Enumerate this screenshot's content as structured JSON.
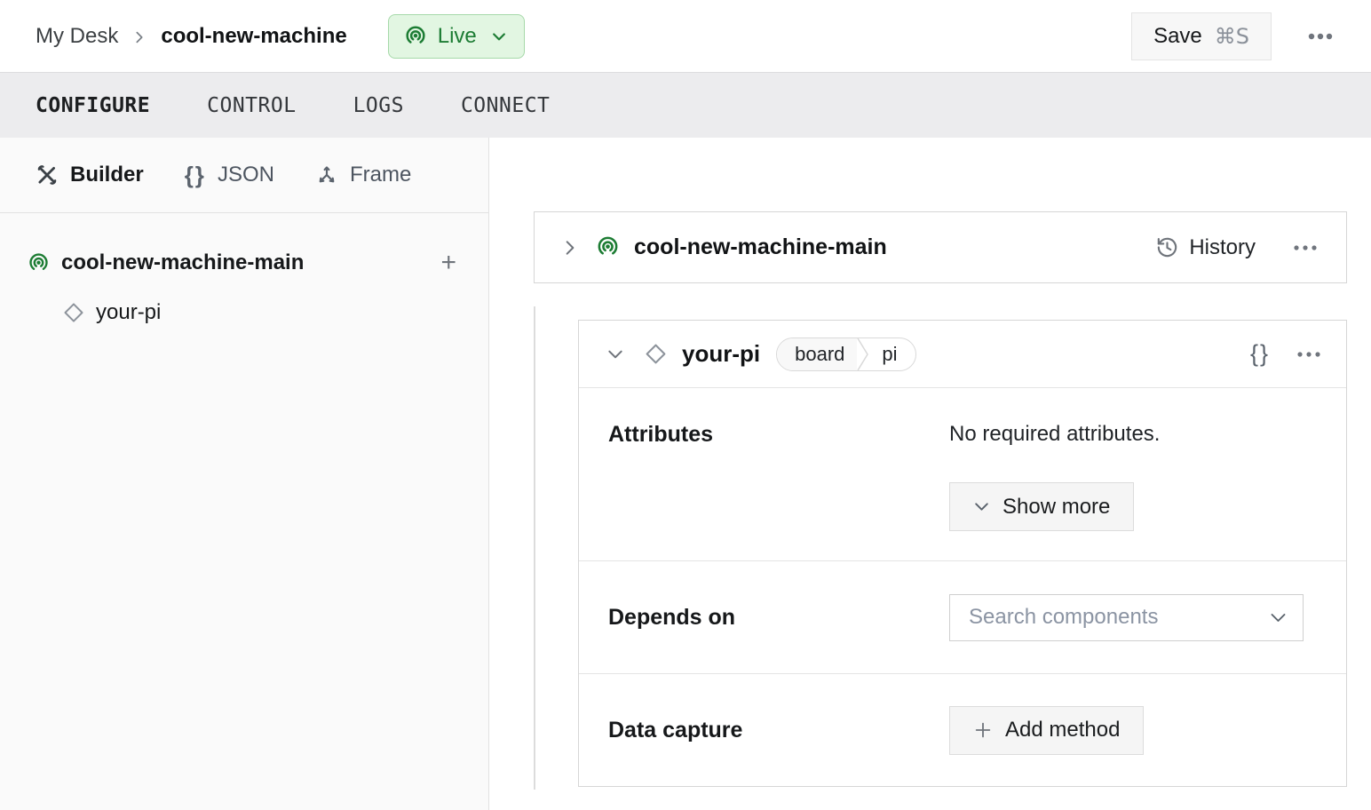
{
  "header": {
    "breadcrumb": {
      "parent": "My Desk",
      "separator": "›",
      "current": "cool-new-machine"
    },
    "live_badge": {
      "label": "Live"
    },
    "save_button": {
      "label": "Save",
      "shortcut": "⌘S"
    }
  },
  "tabs": {
    "configure": "CONFIGURE",
    "control": "CONTROL",
    "logs": "LOGS",
    "connect": "CONNECT",
    "active": "CONFIGURE"
  },
  "sidebar": {
    "modes": {
      "builder": "Builder",
      "json": "JSON",
      "frame": "Frame",
      "active": "Builder"
    },
    "tree": {
      "part": {
        "label": "cool-new-machine-main",
        "add_button": "+"
      },
      "component": {
        "label": "your-pi"
      }
    }
  },
  "main": {
    "part_card": {
      "title": "cool-new-machine-main",
      "history_label": "History"
    },
    "component_card": {
      "title": "your-pi",
      "type_badge": {
        "type": "board",
        "model": "pi"
      },
      "attributes": {
        "label": "Attributes",
        "empty_text": "No required attributes.",
        "show_more_label": "Show more"
      },
      "depends_on": {
        "label": "Depends on",
        "search_placeholder": "Search components"
      },
      "data_capture": {
        "label": "Data capture",
        "add_method_label": "Add method"
      }
    }
  },
  "colors": {
    "live_text": "#1c7c33",
    "live_bg": "#e2f6e2",
    "live_border": "#a6d9a9",
    "tab_bar_bg": "#ececee",
    "sidebar_bg": "#fafafa",
    "card_border": "#d6d6d6",
    "button_bg": "#f5f5f5"
  }
}
